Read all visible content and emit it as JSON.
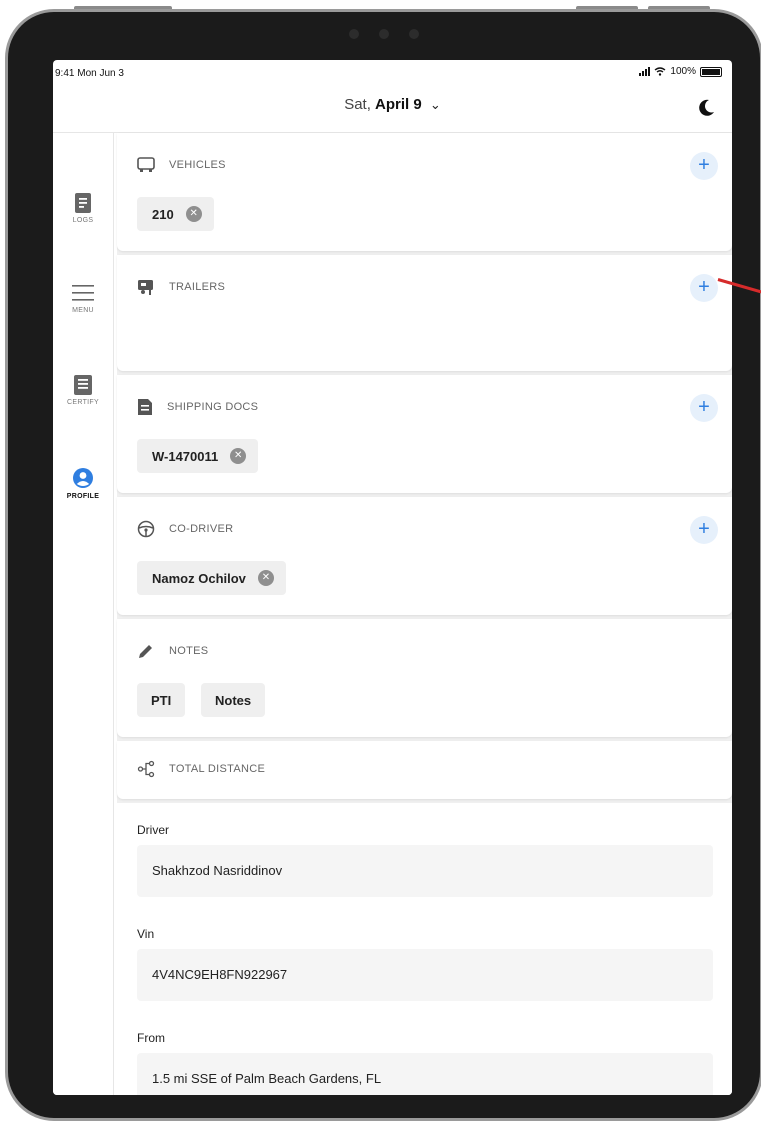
{
  "status_bar": {
    "time": "9:41 Mon Jun 3",
    "battery": "100%"
  },
  "header": {
    "date_weekday": "Sat,",
    "date_day": "April 9",
    "chevron": "⌄"
  },
  "sidebar": {
    "items": [
      {
        "label": "LOGS",
        "icon": "document-icon"
      },
      {
        "label": "MENU",
        "icon": "hamburger-menu-icon"
      },
      {
        "label": "CERTIFY",
        "icon": "certify-document-icon"
      },
      {
        "label": "PROFILE",
        "icon": "user-profile-icon"
      }
    ]
  },
  "sections": {
    "vehicles": {
      "title": "VEHICLES",
      "chips": [
        "210"
      ]
    },
    "trailers": {
      "title": "TRAILERS",
      "chips": []
    },
    "shipping_docs": {
      "title": "SHIPPING DOCS",
      "chips": [
        "W-1470011"
      ]
    },
    "co_driver": {
      "title": "CO-DRIVER",
      "chips": [
        "Namoz Ochilov"
      ]
    },
    "notes": {
      "title": "NOTES",
      "chips": [
        "PTI",
        "Notes"
      ]
    },
    "total_distance": {
      "title": "TOTAL DISTANCE"
    }
  },
  "details": {
    "driver": {
      "label": "Driver",
      "value": "Shakhzod Nasriddinov"
    },
    "vin": {
      "label": "Vin",
      "value": "4V4NC9EH8FN922967"
    },
    "from": {
      "label": "From",
      "value": "1.5 mi SSE of Palm Beach Gardens, FL"
    }
  },
  "colors": {
    "accent": "#2f7ee0",
    "accent_bg": "#e6f0fb",
    "annotation": "#d62b2b"
  }
}
